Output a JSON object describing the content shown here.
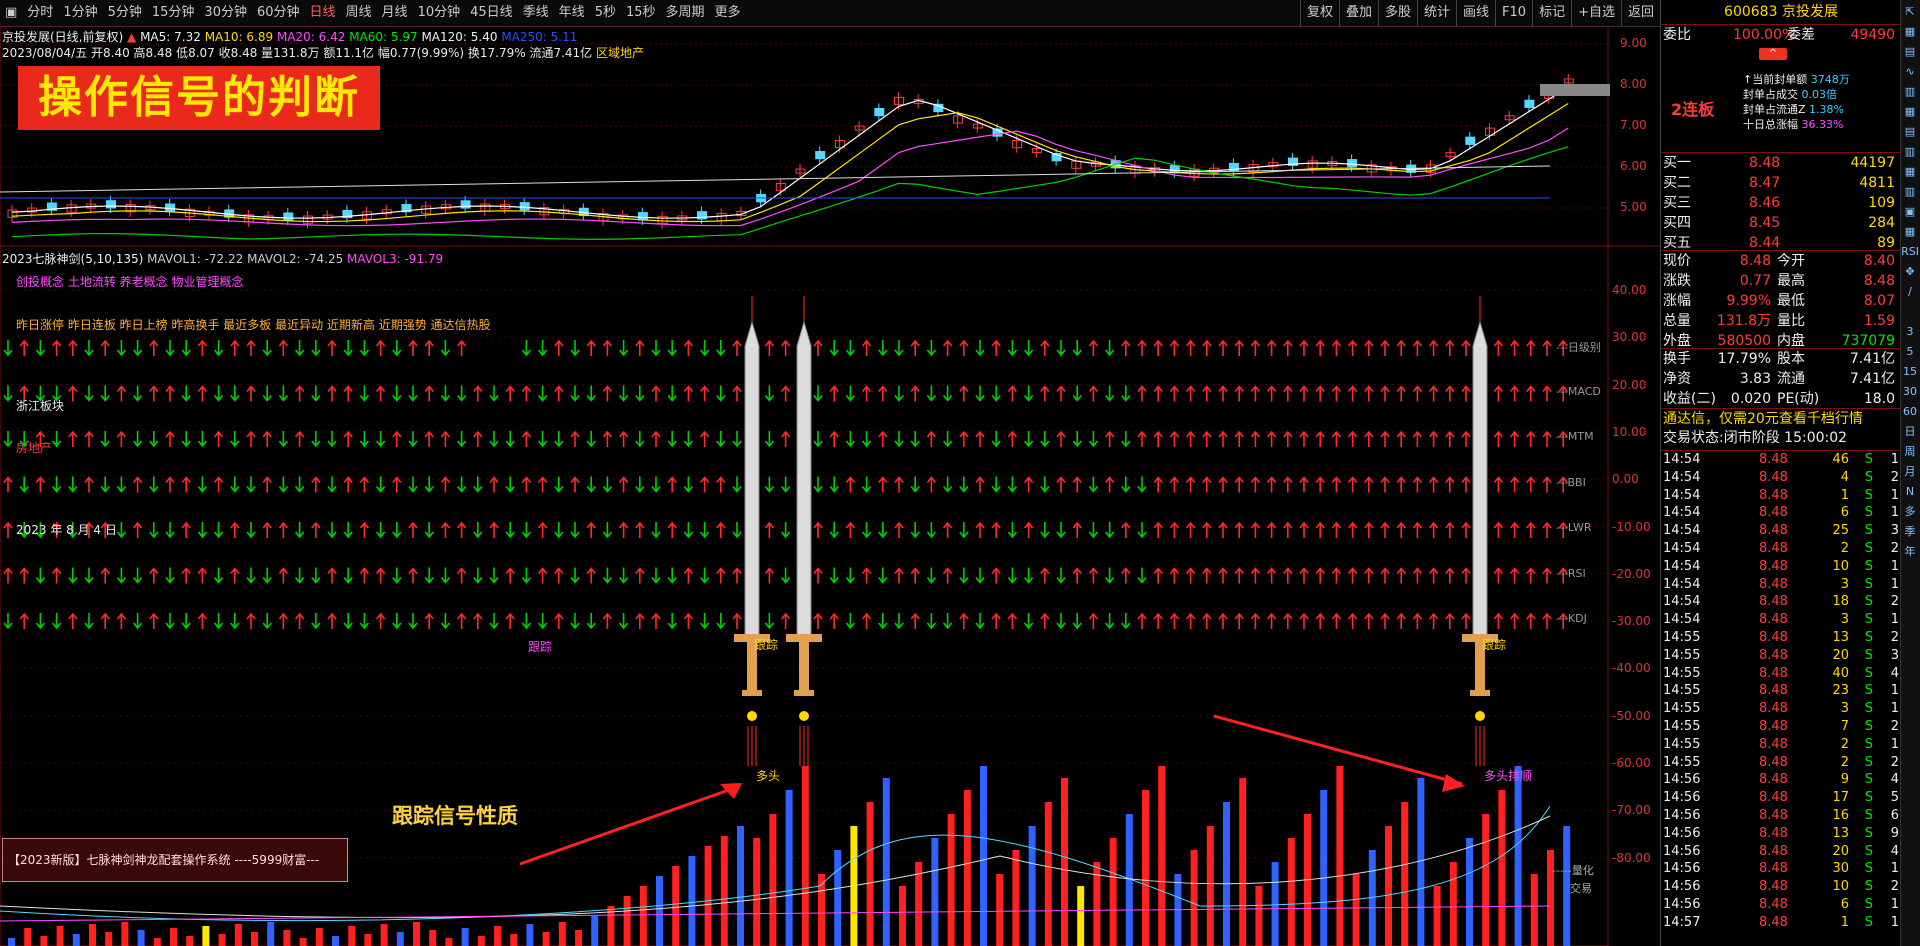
{
  "toolbar": {
    "icon": "panel-toggle-icon",
    "periods": [
      "分时",
      "1分钟",
      "5分钟",
      "15分钟",
      "30分钟",
      "60分钟",
      "日线",
      "周线",
      "月线",
      "10分钟",
      "45日线",
      "季线",
      "年线",
      "5秒",
      "15秒",
      "多周期",
      "更多"
    ],
    "active_period": "日线",
    "buttons": [
      "复权",
      "叠加",
      "多股",
      "统计",
      "画线",
      "F10",
      "标记",
      "+自选",
      "返回"
    ]
  },
  "main_chart": {
    "stock_line": "京投发展(日线,前复权)",
    "ma5": "MA5: 7.32",
    "ma10": "MA10: 6.89",
    "ma20": "MA20: 6.42",
    "ma60": "MA60: 5.97",
    "ma120": "MA120: 5.40",
    "ma250": "MA250: 5.11",
    "ohlc_line": "2023/08/04/五 开8.40 高8.48 低8.07 收8.48 量131.8万 额11.1亿 幅0.77(9.99%) 换17.79% 流通7.41亿",
    "sector": "区域地产",
    "banner": "操作信号的判断",
    "price_axis": [
      "9.00",
      "8.00",
      "7.00",
      "6.00",
      "5.00"
    ],
    "annotations": {
      "high": "8.48",
      "range": "7.71 - 8.07",
      "low1": "4.37",
      "low2": "5.24 - 5.30"
    },
    "bottom_marks": {
      "m1": "减",
      "m2": "财",
      "m3": "涨停"
    }
  },
  "indicator": {
    "title": "2023七脉神剑(5,10,135)",
    "mavol1": "MAVOL1: -72.22",
    "mavol2": "MAVOL2: -74.25",
    "mavol3": "MAVOL3: -91.79",
    "concepts": "创投概念 土地流转 养老概念 物业管理概念",
    "tags": "昨日涨停 昨日连板 昨日上榜 昨高换手 最近多板 最近异动 近期新高 近期强势 通达信热股",
    "block": "浙江板块",
    "industry": "房地产",
    "date": "2023 年 8 月 4 日",
    "row_labels": [
      "---日级别",
      "---MACD",
      "---MTM",
      "---BBI",
      "---LWR",
      "---RSI",
      "---KDJ"
    ],
    "axis": [
      "40.00",
      "30.00",
      "20.00",
      "10.00",
      "0.00",
      "-10.00",
      "-20.00",
      "-30.00",
      "-40.00",
      "-50.00",
      "-60.00",
      "-70.00",
      "-80.00"
    ],
    "track1": "跟踪",
    "track2": "跟踪",
    "track3": "跟踪",
    "track_small": "跟踪",
    "duotou1": "多头",
    "duotou2": "多头",
    "paishun": "排顺",
    "signal_caption": "跟踪信号性质",
    "system_box": "【2023新版】七脉神剑神龙配套操作系统 ----5999财富---",
    "lianghua": "-----量化",
    "jiaoyi": "交易"
  },
  "right_panel": {
    "code": "600683",
    "name": "京投发展",
    "weibi_label": "委比",
    "weibi_value": "100.00%",
    "weicha_label": "委差",
    "weicha_value": "49490",
    "lianban": "2连板",
    "seal_info": [
      {
        "label": "↑当前封单额",
        "value": "3748万"
      },
      {
        "label": "封单占成交",
        "value": "0.03倍"
      },
      {
        "label": "封单占流通Z",
        "value": "1.38%"
      },
      {
        "label": "十日总涨幅",
        "value": "36.33%"
      }
    ],
    "bids": [
      {
        "label": "买一",
        "price": "8.48",
        "vol": "44197"
      },
      {
        "label": "买二",
        "price": "8.47",
        "vol": "4811"
      },
      {
        "label": "买三",
        "price": "8.46",
        "vol": "109"
      },
      {
        "label": "买四",
        "price": "8.45",
        "vol": "284"
      },
      {
        "label": "买五",
        "price": "8.44",
        "vol": "89"
      }
    ],
    "stats": [
      {
        "l1": "现价",
        "v1": "8.48",
        "l2": "今开",
        "v2": "8.40"
      },
      {
        "l1": "涨跌",
        "v1": "0.77",
        "l2": "最高",
        "v2": "8.48"
      },
      {
        "l1": "涨幅",
        "v1": "9.99%",
        "l2": "最低",
        "v2": "8.07"
      },
      {
        "l1": "总量",
        "v1": "131.8万",
        "l2": "量比",
        "v2": "1.59"
      },
      {
        "l1": "外盘",
        "v1": "580500",
        "l2": "内盘",
        "v2": "737079"
      }
    ],
    "stats2": [
      {
        "l1": "换手",
        "v1": "17.79%",
        "l2": "股本",
        "v2": "7.41亿"
      },
      {
        "l1": "净资",
        "v1": "3.83",
        "l2": "流通",
        "v2": "7.41亿"
      },
      {
        "l1": "收益(二)",
        "v1": "0.020",
        "l2": "PE(动)",
        "v2": "18.0"
      }
    ],
    "promo": "通达信，仅需20元查看千档行情",
    "trade_state": "交易状态:闭市阶段 15:00:02",
    "ticks": [
      [
        "14:54",
        "8.48",
        "46",
        "S",
        "1"
      ],
      [
        "14:54",
        "8.48",
        "4",
        "S",
        "2"
      ],
      [
        "14:54",
        "8.48",
        "1",
        "S",
        "1"
      ],
      [
        "14:54",
        "8.48",
        "6",
        "S",
        "1"
      ],
      [
        "14:54",
        "8.48",
        "25",
        "S",
        "3"
      ],
      [
        "14:54",
        "8.48",
        "2",
        "S",
        "2"
      ],
      [
        "14:54",
        "8.48",
        "10",
        "S",
        "1"
      ],
      [
        "14:54",
        "8.48",
        "3",
        "S",
        "1"
      ],
      [
        "14:54",
        "8.48",
        "18",
        "S",
        "2"
      ],
      [
        "14:54",
        "8.48",
        "3",
        "S",
        "1"
      ],
      [
        "14:55",
        "8.48",
        "13",
        "S",
        "2"
      ],
      [
        "14:55",
        "8.48",
        "20",
        "S",
        "3"
      ],
      [
        "14:55",
        "8.48",
        "40",
        "S",
        "4"
      ],
      [
        "14:55",
        "8.48",
        "23",
        "S",
        "1"
      ],
      [
        "14:55",
        "8.48",
        "3",
        "S",
        "1"
      ],
      [
        "14:55",
        "8.48",
        "7",
        "S",
        "2"
      ],
      [
        "14:55",
        "8.48",
        "2",
        "S",
        "1"
      ],
      [
        "14:55",
        "8.48",
        "2",
        "S",
        "2"
      ],
      [
        "14:56",
        "8.48",
        "9",
        "S",
        "4"
      ],
      [
        "14:56",
        "8.48",
        "17",
        "S",
        "5"
      ],
      [
        "14:56",
        "8.48",
        "16",
        "S",
        "6"
      ],
      [
        "14:56",
        "8.48",
        "13",
        "S",
        "9"
      ],
      [
        "14:56",
        "8.48",
        "20",
        "S",
        "4"
      ],
      [
        "14:56",
        "8.48",
        "30",
        "S",
        "1"
      ],
      [
        "14:56",
        "8.48",
        "10",
        "S",
        "2"
      ],
      [
        "14:56",
        "8.48",
        "6",
        "S",
        "1"
      ],
      [
        "14:57",
        "8.48",
        "1",
        "S",
        "1"
      ]
    ]
  },
  "side_icons": [
    "⇱",
    "▦",
    "▤",
    "∿",
    "▥",
    "▦",
    "▤",
    "▥",
    "▦",
    "▥",
    "▣",
    "▦",
    "RSI",
    "✥",
    "∕",
    "",
    "3",
    "5",
    "15",
    "30",
    "60",
    "日",
    "周",
    "月",
    "N",
    "多",
    "季",
    "年"
  ]
}
